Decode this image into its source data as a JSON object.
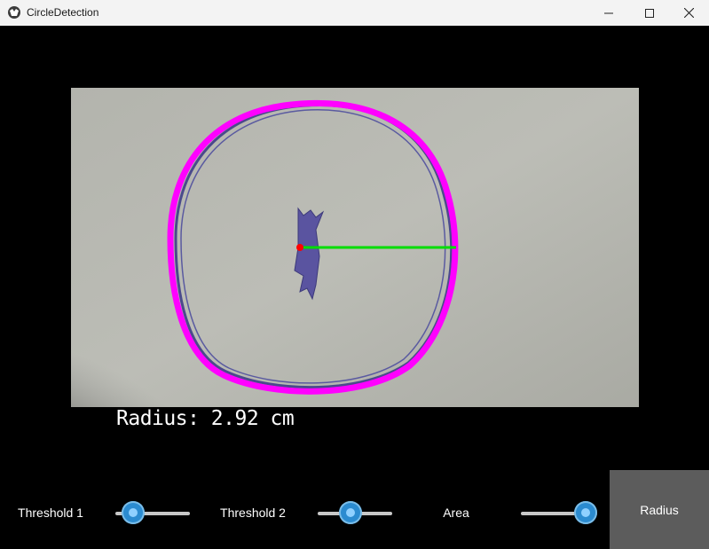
{
  "window": {
    "title": "CircleDetection",
    "icons": {
      "app": "kivy-icon",
      "minimize": "minimize-icon",
      "maximize": "maximize-icon",
      "close": "close-icon"
    }
  },
  "overlay": {
    "radius_text": "Radius: 2.92 cm",
    "circle_color": "#ff00ff",
    "radius_line_color": "#00dd00",
    "center_color": "#ff0000"
  },
  "controls": {
    "threshold1": {
      "label": "Threshold 1",
      "value": 0.2
    },
    "threshold2": {
      "label": "Threshold 2",
      "value": 0.45
    },
    "area": {
      "label": "Area",
      "value": 0.9
    },
    "radius_button": "Radius"
  }
}
